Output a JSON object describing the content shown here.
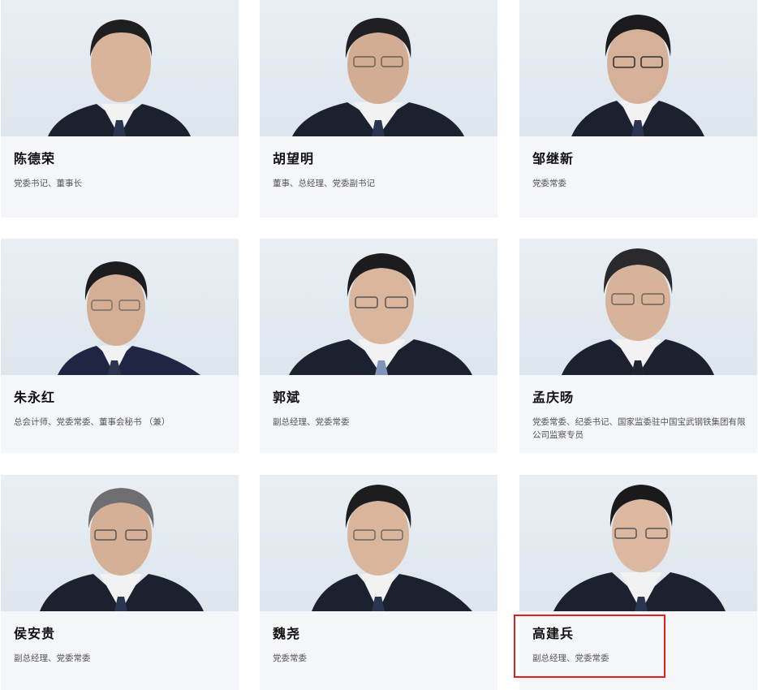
{
  "people": [
    {
      "name": "陈德荣",
      "title": "党委书记、董事长"
    },
    {
      "name": "胡望明",
      "title": "董事、总经理、党委副书记"
    },
    {
      "name": "邹继新",
      "title": "党委常委"
    },
    {
      "name": "朱永红",
      "title": "总会计师、党委常委、董事会秘书 （兼）"
    },
    {
      "name": "郭斌",
      "title": "副总经理、党委常委"
    },
    {
      "name": "孟庆旸",
      "title": "党委常委、纪委书记、国家监委驻中国宝武钢铁集团有限公司监察专员"
    },
    {
      "name": "侯安贵",
      "title": "副总经理、党委常委"
    },
    {
      "name": "魏尧",
      "title": "党委常委"
    },
    {
      "name": "高建兵",
      "title": "副总经理、党委常委"
    }
  ],
  "highlighted_index": 8,
  "colors": {
    "card_bg": "#f5f6fa",
    "photo_bg": "#e3eaf0",
    "suit": "#1c2130",
    "highlight": "#e02020"
  }
}
